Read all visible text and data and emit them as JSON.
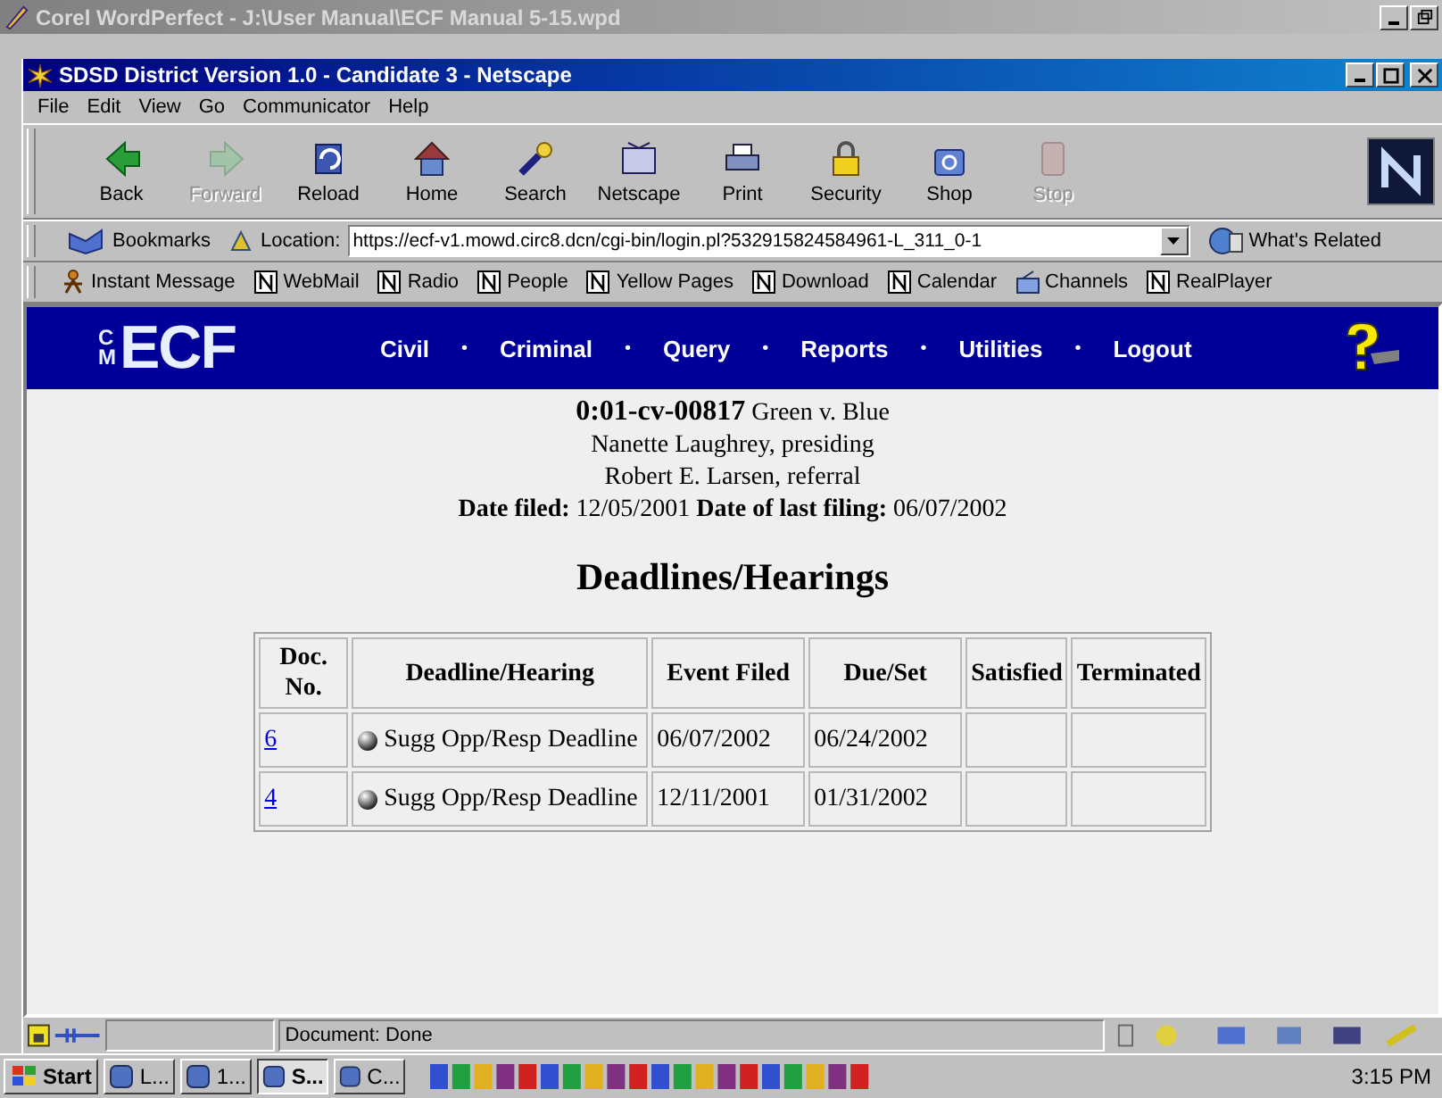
{
  "outer_window": {
    "title": "Corel WordPerfect - J:\\User Manual\\ECF Manual 5-15.wpd"
  },
  "browser_window": {
    "title": "SDSD District Version 1.0 - Candidate 3 - Netscape"
  },
  "menu": [
    "File",
    "Edit",
    "View",
    "Go",
    "Communicator",
    "Help"
  ],
  "toolbar": [
    {
      "label": "Back",
      "disabled": false
    },
    {
      "label": "Forward",
      "disabled": true
    },
    {
      "label": "Reload",
      "disabled": false
    },
    {
      "label": "Home",
      "disabled": false
    },
    {
      "label": "Search",
      "disabled": false
    },
    {
      "label": "Netscape",
      "disabled": false
    },
    {
      "label": "Print",
      "disabled": false
    },
    {
      "label": "Security",
      "disabled": false
    },
    {
      "label": "Shop",
      "disabled": false
    },
    {
      "label": "Stop",
      "disabled": true
    }
  ],
  "location_bar": {
    "bookmarks": "Bookmarks",
    "location_label": "Location:",
    "url": "https://ecf-v1.mowd.circ8.dcn/cgi-bin/login.pl?532915824584961-L_311_0-1",
    "whats_related": "What's Related"
  },
  "personal_toolbar": [
    {
      "label": "Instant Message",
      "kind": "person"
    },
    {
      "label": "WebMail",
      "kind": "page"
    },
    {
      "label": "Radio",
      "kind": "page"
    },
    {
      "label": "People",
      "kind": "page"
    },
    {
      "label": "Yellow Pages",
      "kind": "page"
    },
    {
      "label": "Download",
      "kind": "page"
    },
    {
      "label": "Calendar",
      "kind": "page"
    },
    {
      "label": "Channels",
      "kind": "channel"
    },
    {
      "label": "RealPlayer",
      "kind": "page"
    }
  ],
  "ecf_banner": {
    "logo_small": "CM",
    "logo": "ECF",
    "nav": [
      {
        "kind": "link",
        "text": "Civil"
      },
      {
        "kind": "separator",
        "text": "•"
      },
      {
        "kind": "link",
        "text": "Criminal"
      },
      {
        "kind": "separator",
        "text": "•"
      },
      {
        "kind": "link",
        "text": "Query"
      },
      {
        "kind": "separator",
        "text": "•"
      },
      {
        "kind": "link",
        "text": "Reports"
      },
      {
        "kind": "separator",
        "text": "•"
      },
      {
        "kind": "link",
        "text": "Utilities"
      },
      {
        "kind": "separator",
        "text": "•"
      },
      {
        "kind": "link",
        "text": "Logout"
      }
    ]
  },
  "case_header": {
    "case_number": "0:01-cv-00817",
    "case_name": "Green v. Blue",
    "presiding": "Nanette Laughrey, presiding",
    "referral": "Robert E. Larsen, referral",
    "date_filed_label": "Date filed:",
    "date_filed": "12/05/2001",
    "last_filing_label": "Date of last filing:",
    "last_filing": "06/07/2002"
  },
  "heading": "Deadlines/Hearings",
  "table": {
    "columns": [
      "Doc. No.",
      "Deadline/Hearing",
      "Event Filed",
      "Due/Set",
      "Satisfied",
      "Terminated"
    ],
    "rows": [
      {
        "doc_no": "6",
        "deadline": "Sugg Opp/Resp Deadline",
        "event_filed": "06/07/2002",
        "due_set": "06/24/2002"
      },
      {
        "doc_no": "4",
        "deadline": "Sugg Opp/Resp Deadline",
        "event_filed": "12/11/2001",
        "due_set": "01/31/2002"
      }
    ]
  },
  "status_bar": {
    "text": "Document: Done"
  },
  "taskbar": {
    "start": "Start",
    "tasks": [
      {
        "label": "L...",
        "selected": false
      },
      {
        "label": "1...",
        "selected": false
      },
      {
        "label": "S...",
        "selected": true
      },
      {
        "label": "C...",
        "selected": false
      }
    ],
    "clock": "3:15 PM"
  }
}
